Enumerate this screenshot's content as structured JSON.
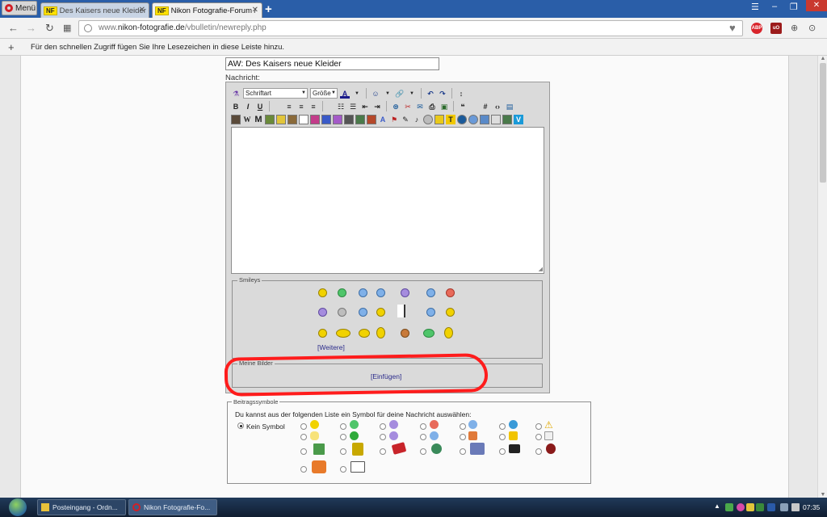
{
  "browser": {
    "menu_label": "Menü",
    "tabs": [
      {
        "label": "Des Kaisers neue Kleider -",
        "favicon": "NF"
      },
      {
        "label": "Nikon Fotografie-Forum /",
        "favicon": "NF"
      }
    ],
    "url_prefix": "www.",
    "url_host": "nikon-fotografie.de",
    "url_path": "/vbulletin/newreply.php",
    "bookmark_hint": "Für den schnellen Zugriff fügen Sie Ihre Lesezeichen in diese Leiste hinzu.",
    "extensions": [
      {
        "name": "adblock-plus",
        "label": "ABP",
        "color": "#d9252c"
      },
      {
        "name": "ublock",
        "label": "uO",
        "color": "#9c1b1b"
      }
    ]
  },
  "form": {
    "title_value": "AW: Des Kaisers neue Kleider",
    "message_label": "Nachricht:",
    "font_select": "Schriftart",
    "size_select": "Größe",
    "smileys_legend": "Smileys",
    "more_smileys_link": "[Weitere]",
    "my_images_legend": "Meine Bilder",
    "insert_link": "[Einfügen]",
    "post_icons": {
      "legend": "Beitragssymbole",
      "description": "Du kannst aus der folgenden Liste ein Symbol für deine Nachricht auswählen:",
      "no_icon_label": "Kein Symbol",
      "selected": "Kein Symbol"
    }
  },
  "taskbar": {
    "items": [
      {
        "label": "Posteingang - Ordn...",
        "active": false
      },
      {
        "label": "Nikon Fotografie-Fo...",
        "active": true
      }
    ],
    "clock": "07:35"
  },
  "colors": {
    "annotation_circle": "#ff1c1c",
    "tab_accent": "#2a5ea8",
    "link": "#2a2a8a"
  }
}
